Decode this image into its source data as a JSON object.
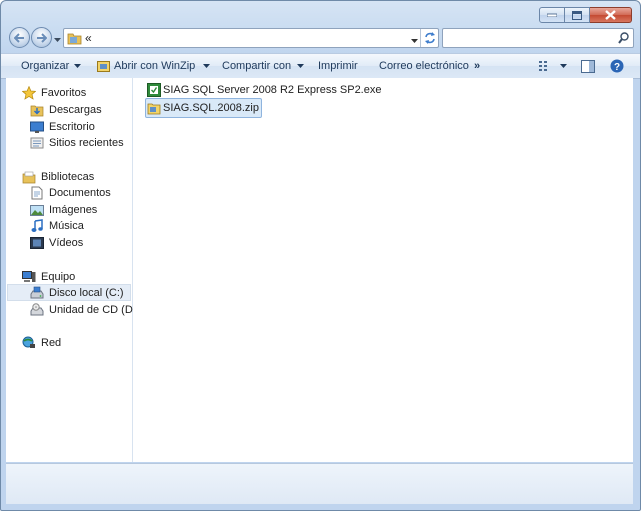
{
  "address": {
    "path_text": "«"
  },
  "search": {
    "placeholder": ""
  },
  "toolbar": {
    "organize": "Organizar",
    "winzip": "Abrir con WinZip",
    "share": "Compartir con",
    "print": "Imprimir",
    "email": "Correo electrónico",
    "more": "»"
  },
  "sidebar": {
    "favorites": {
      "label": "Favoritos",
      "items": [
        "Descargas",
        "Escritorio",
        "Sitios recientes"
      ]
    },
    "libraries": {
      "label": "Bibliotecas",
      "items": [
        "Documentos",
        "Imágenes",
        "Música",
        "Vídeos"
      ]
    },
    "computer": {
      "label": "Equipo",
      "items": [
        "Disco local (C:)",
        "Unidad de CD (D:)"
      ]
    },
    "network": {
      "label": "Red"
    }
  },
  "files": [
    {
      "name": "SIAG SQL Server 2008 R2 Express SP2.exe",
      "icon": "installer-icon",
      "selected": false
    },
    {
      "name": "SIAG.SQL.2008.zip",
      "icon": "zip-archive-icon",
      "selected": true
    }
  ],
  "colors": {
    "accent": "#1e395b",
    "selection": "#cce4f7",
    "chrome": "#c9dcf1"
  }
}
